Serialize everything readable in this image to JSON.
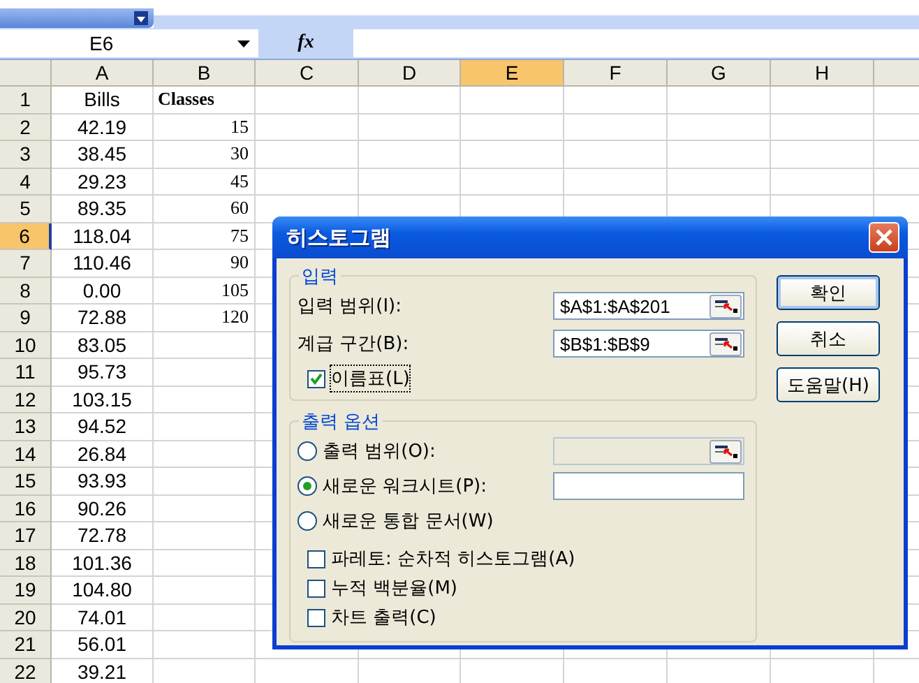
{
  "name_box": "E6",
  "formula_label": "fx",
  "columns": [
    {
      "label": "A",
      "selected": false
    },
    {
      "label": "B",
      "selected": false
    },
    {
      "label": "C",
      "selected": false
    },
    {
      "label": "D",
      "selected": false
    },
    {
      "label": "E",
      "selected": true
    },
    {
      "label": "F",
      "selected": false
    },
    {
      "label": "G",
      "selected": false
    },
    {
      "label": "H",
      "selected": false
    }
  ],
  "rows": [
    {
      "number": "1",
      "selected": false,
      "kind": "header",
      "cells": [
        "Bills",
        "Classes"
      ]
    },
    {
      "number": "2",
      "selected": false,
      "kind": "data",
      "cells": [
        "42.19",
        "15"
      ]
    },
    {
      "number": "3",
      "selected": false,
      "kind": "data",
      "cells": [
        "38.45",
        "30"
      ]
    },
    {
      "number": "4",
      "selected": false,
      "kind": "data",
      "cells": [
        "29.23",
        "45"
      ]
    },
    {
      "number": "5",
      "selected": false,
      "kind": "data",
      "cells": [
        "89.35",
        "60"
      ]
    },
    {
      "number": "6",
      "selected": true,
      "kind": "data",
      "cells": [
        "118.04",
        "75"
      ]
    },
    {
      "number": "7",
      "selected": false,
      "kind": "data",
      "cells": [
        "110.46",
        "90"
      ]
    },
    {
      "number": "8",
      "selected": false,
      "kind": "data",
      "cells": [
        "0.00",
        "105"
      ]
    },
    {
      "number": "9",
      "selected": false,
      "kind": "data",
      "cells": [
        "72.88",
        "120"
      ]
    },
    {
      "number": "10",
      "selected": false,
      "kind": "data",
      "cells": [
        "83.05"
      ]
    },
    {
      "number": "11",
      "selected": false,
      "kind": "data",
      "cells": [
        "95.73"
      ]
    },
    {
      "number": "12",
      "selected": false,
      "kind": "data",
      "cells": [
        "103.15"
      ]
    },
    {
      "number": "13",
      "selected": false,
      "kind": "data",
      "cells": [
        "94.52"
      ]
    },
    {
      "number": "14",
      "selected": false,
      "kind": "data",
      "cells": [
        "26.84"
      ]
    },
    {
      "number": "15",
      "selected": false,
      "kind": "data",
      "cells": [
        "93.93"
      ]
    },
    {
      "number": "16",
      "selected": false,
      "kind": "data",
      "cells": [
        "90.26"
      ]
    },
    {
      "number": "17",
      "selected": false,
      "kind": "data",
      "cells": [
        "72.78"
      ]
    },
    {
      "number": "18",
      "selected": false,
      "kind": "data",
      "cells": [
        "101.36"
      ]
    },
    {
      "number": "19",
      "selected": false,
      "kind": "data",
      "cells": [
        "104.80"
      ]
    },
    {
      "number": "20",
      "selected": false,
      "kind": "data",
      "cells": [
        "74.01"
      ]
    },
    {
      "number": "21",
      "selected": false,
      "kind": "data",
      "cells": [
        "56.01"
      ]
    },
    {
      "number": "22",
      "selected": false,
      "kind": "data",
      "cells": [
        "39.21"
      ]
    }
  ],
  "dialog": {
    "title": "히스토그램",
    "input_group": {
      "title": "입력",
      "fields": [
        {
          "label": "입력 범위(I):",
          "value": "$A$1:$A$201"
        },
        {
          "label": "계급 구간(B):",
          "value": "$B$1:$B$9"
        }
      ],
      "labels_checkbox": {
        "label": "이름표(L)",
        "checked": true
      }
    },
    "output_group": {
      "title": "출력 옵션",
      "options": [
        {
          "label": "출력 범위(O):",
          "selected": false,
          "field": {
            "disabled": true,
            "picker": true
          }
        },
        {
          "label": "새로운 워크시트(P):",
          "selected": true,
          "field": {
            "disabled": false,
            "picker": false
          }
        },
        {
          "label": "새로운 통합 문서(W)",
          "selected": false
        }
      ],
      "checkboxes": [
        {
          "label": "파레토: 순차적 히스토그램(A)",
          "checked": false
        },
        {
          "label": "누적 백분율(M)",
          "checked": false
        },
        {
          "label": "차트 출력(C)",
          "checked": false
        }
      ]
    },
    "buttons": [
      "확인",
      "취소",
      "도움말(H)"
    ]
  }
}
